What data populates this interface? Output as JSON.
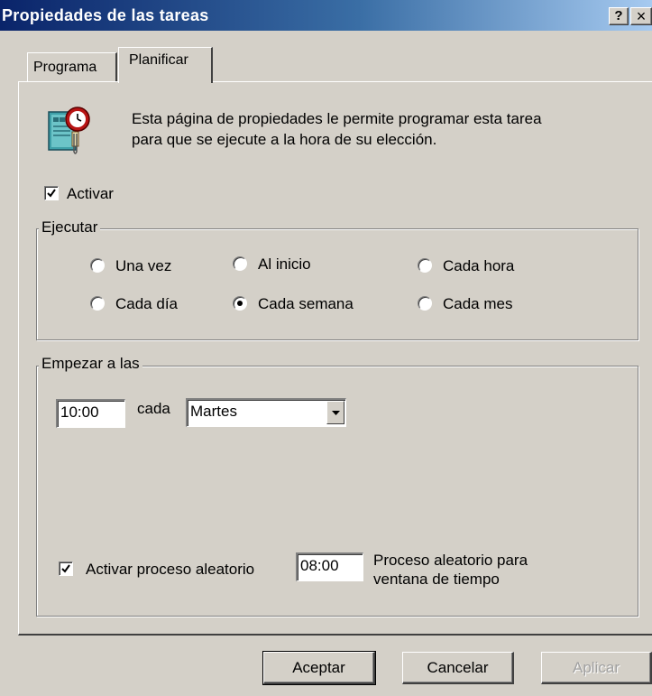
{
  "window": {
    "title": "Propiedades de las tareas",
    "help_label": "?",
    "close_label": "×"
  },
  "tabs": [
    {
      "label": "Programa",
      "selected": false
    },
    {
      "label": "Planificar",
      "selected": true
    }
  ],
  "header": {
    "icon": "scheduled-task-clock-icon",
    "description_line1": "Esta página de propiedades le permite programar esta tarea",
    "description_line2": "para que se ejecute a la hora de su elección."
  },
  "enable": {
    "label": "Activar",
    "checked": true
  },
  "ejecutar": {
    "legend": "Ejecutar",
    "options": [
      {
        "label": "Una vez",
        "selected": false
      },
      {
        "label": "Al inicio",
        "selected": false
      },
      {
        "label": "Cada hora",
        "selected": false
      },
      {
        "label": "Cada día",
        "selected": false
      },
      {
        "label": "Cada semana",
        "selected": true
      },
      {
        "label": "Cada mes",
        "selected": false
      }
    ]
  },
  "start": {
    "legend": "Empezar a las",
    "time": "10:00",
    "every_label": "cada",
    "day_selected": "Martes",
    "random": {
      "label": "Activar proceso aleatorio",
      "checked": true,
      "time": "08:00",
      "desc_line1": "Proceso aleatorio para",
      "desc_line2": "ventana de tiempo"
    }
  },
  "buttons": {
    "ok": "Aceptar",
    "cancel": "Cancelar",
    "apply": "Aplicar",
    "apply_enabled": false
  },
  "colors": {
    "titlebar_start": "#0a246a",
    "titlebar_end": "#a6caf0",
    "face": "#d4d0c8"
  }
}
